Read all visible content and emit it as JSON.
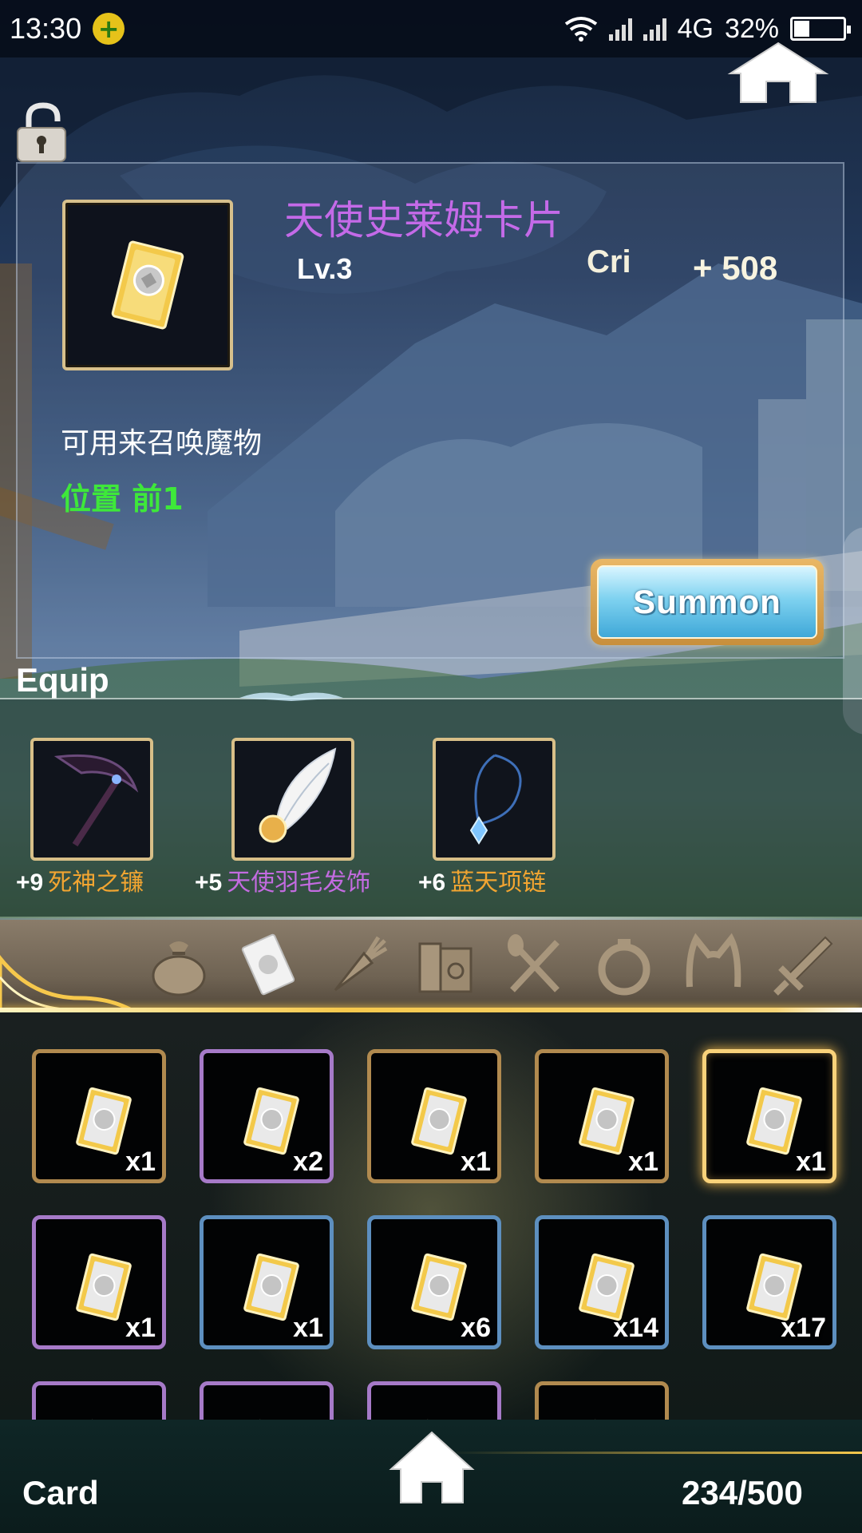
{
  "status_bar": {
    "time": "13:30",
    "network": "4G",
    "battery": "32%"
  },
  "item": {
    "name": "天使史莱姆卡片",
    "level": "Lv.3",
    "stat_name": "Cri",
    "stat_value": "+ 508",
    "description": "可用来召唤魔物",
    "position": "位置 前1"
  },
  "summon_button": {
    "label": "Summon"
  },
  "equip": {
    "title": "Equip",
    "slots": [
      {
        "plus": "+9",
        "name": "死神之镰",
        "name_color": "#f2a531",
        "icon": "scythe-icon"
      },
      {
        "plus": "+5",
        "name": "天使羽毛发饰",
        "name_color": "#c36be0",
        "icon": "angel-feather-icon"
      },
      {
        "plus": "+6",
        "name": "蓝天项链",
        "name_color": "#f2a531",
        "icon": "necklace-icon"
      }
    ]
  },
  "category_tabs": [
    {
      "icon": "bag-icon",
      "active": false
    },
    {
      "icon": "card-icon",
      "active": true
    },
    {
      "icon": "carrot-icon",
      "active": false
    },
    {
      "icon": "book-icon",
      "active": false
    },
    {
      "icon": "utensils-icon",
      "active": false
    },
    {
      "icon": "ring-icon",
      "active": false
    },
    {
      "icon": "cat-ears-icon",
      "active": false
    },
    {
      "icon": "sword-icon",
      "active": false
    }
  ],
  "inventory": [
    {
      "qty": "x1",
      "rarity": "gold"
    },
    {
      "qty": "x2",
      "rarity": "purple"
    },
    {
      "qty": "x1",
      "rarity": "gold"
    },
    {
      "qty": "x1",
      "rarity": "gold"
    },
    {
      "qty": "x1",
      "rarity": "gold",
      "selected": true
    },
    {
      "qty": "x1",
      "rarity": "purple"
    },
    {
      "qty": "x1",
      "rarity": "blue"
    },
    {
      "qty": "x6",
      "rarity": "blue"
    },
    {
      "qty": "x14",
      "rarity": "blue"
    },
    {
      "qty": "x17",
      "rarity": "blue"
    },
    {
      "qty": "",
      "rarity": "purple"
    },
    {
      "qty": "",
      "rarity": "purple"
    },
    {
      "qty": "",
      "rarity": "purple"
    },
    {
      "qty": "",
      "rarity": "gold"
    }
  ],
  "footer": {
    "label": "Card",
    "count": "234/500"
  },
  "colors": {
    "item_name": "#c46ae8",
    "position_text": "#3ee83a",
    "gold_accent": "#f6c84c"
  }
}
